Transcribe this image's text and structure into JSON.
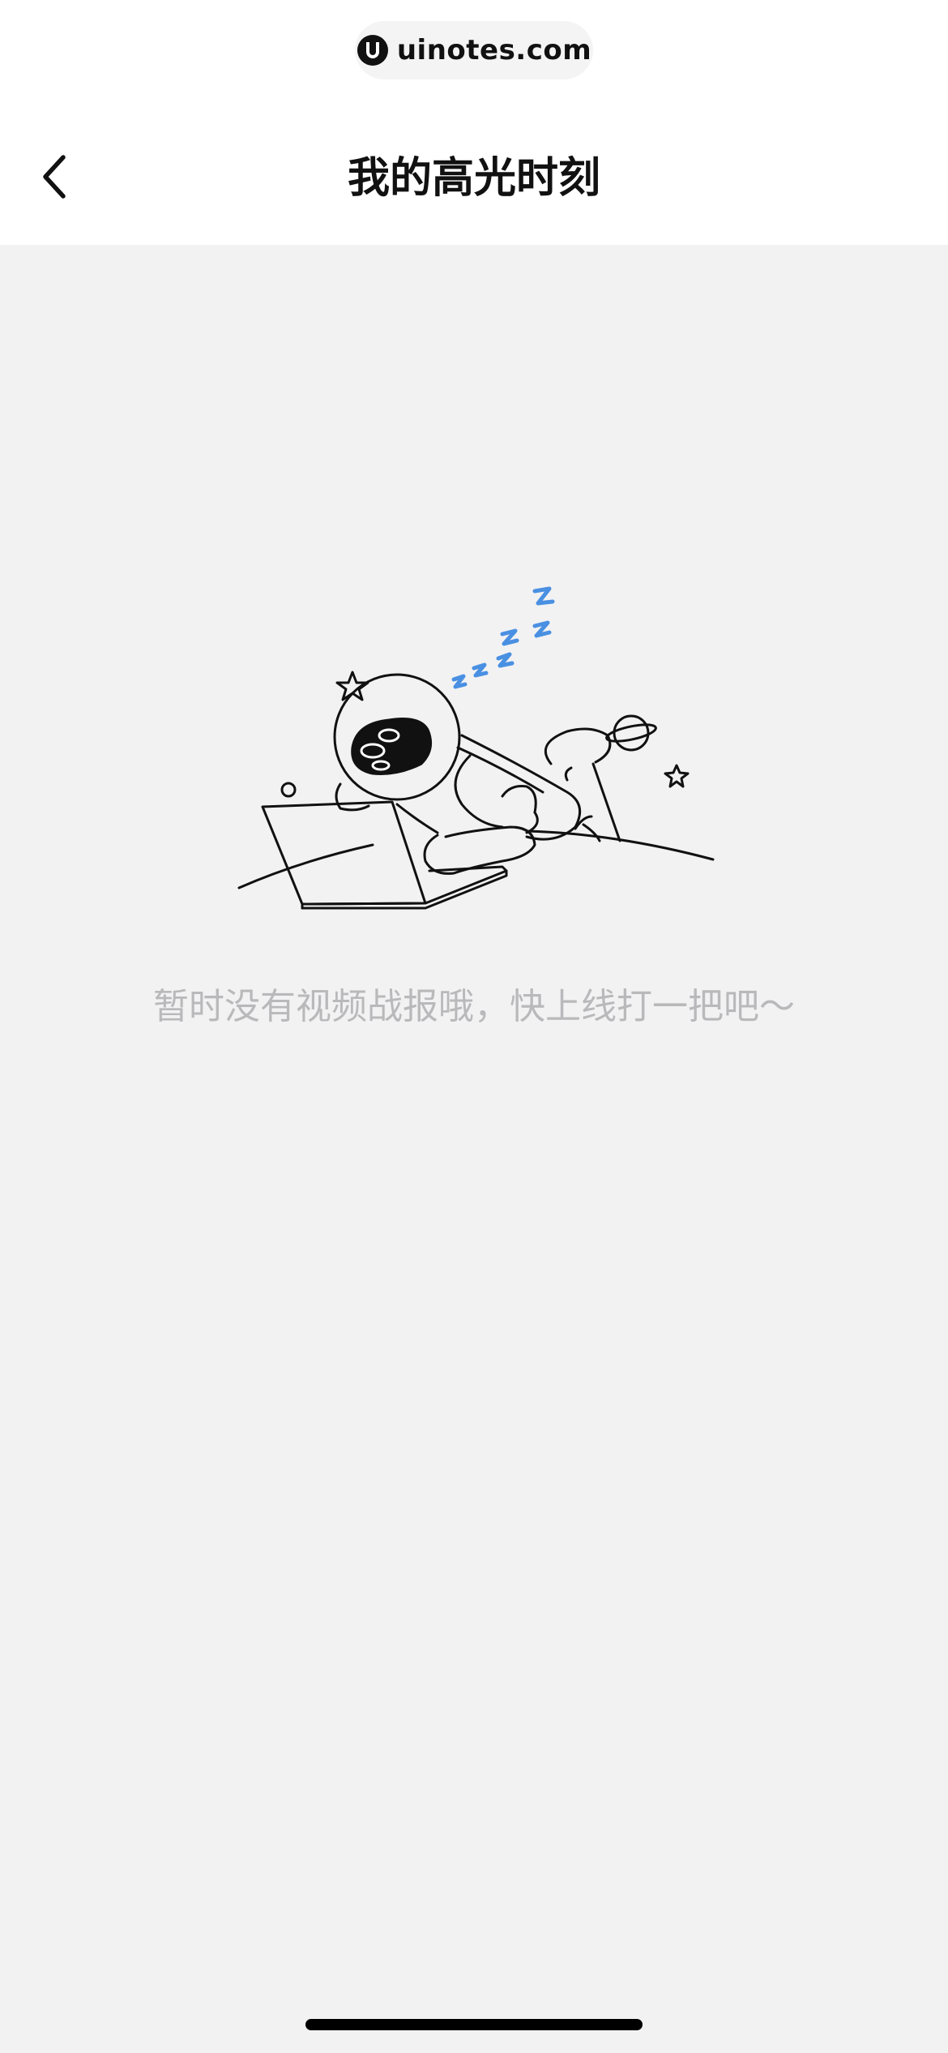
{
  "watermark": {
    "text": "uinotes.com",
    "icon": "uinotes-logo-icon"
  },
  "nav": {
    "back_icon": "chevron-left-icon",
    "title": "我的高光时刻"
  },
  "empty_state": {
    "illustration": "sleeping-astronaut-laptop-illustration",
    "message": "暂时没有视频战报哦，快上线打一把吧～"
  },
  "colors": {
    "background": "#f2f2f3",
    "header": "#ffffff",
    "accent_zzz": "#4a90e2",
    "message_text": "#b9b9bb"
  }
}
